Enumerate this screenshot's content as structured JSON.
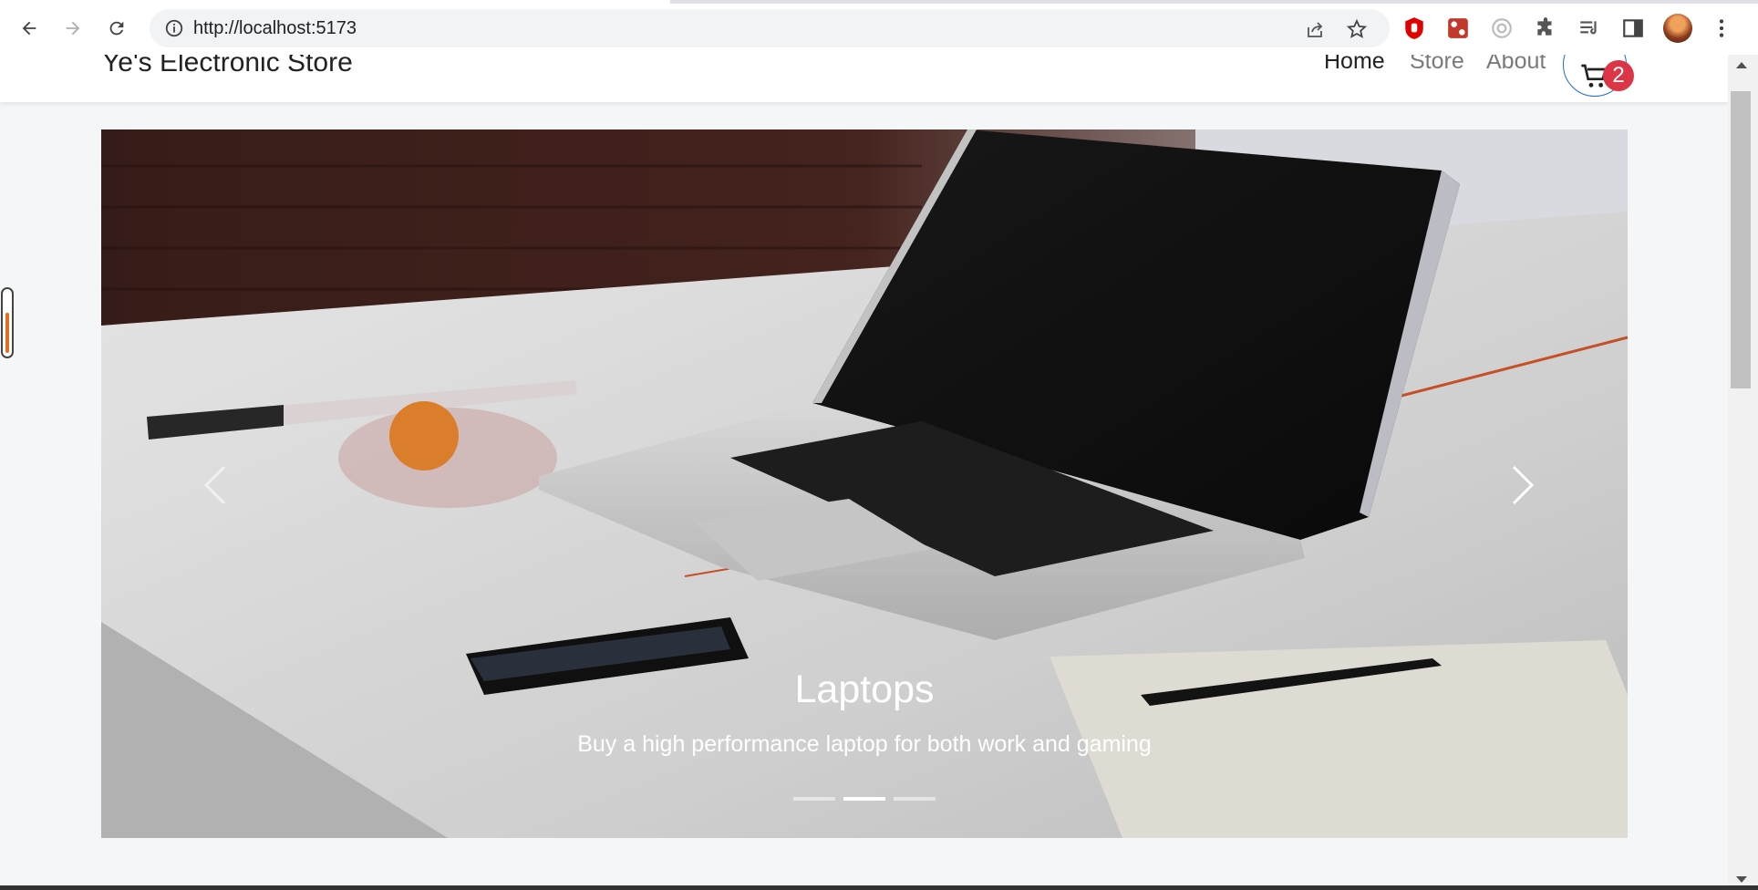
{
  "browser": {
    "url": "http://localhost:5173",
    "colors": {
      "omnibox": "#f1f3f4",
      "chrome": "#ffffff"
    }
  },
  "navbar": {
    "brand": "Ye's Electronic Store",
    "links": [
      {
        "label": "Home",
        "active": true
      },
      {
        "label": "Store",
        "active": false
      },
      {
        "label": "About",
        "active": false
      }
    ],
    "cart_count": "2",
    "colors": {
      "cart_border": "#1e6cc9",
      "badge": "#dc3545"
    }
  },
  "carousel": {
    "title": "Laptops",
    "subtitle": "Buy a high performance laptop for both work and gaming",
    "slide_count": 3,
    "active_index": 1
  }
}
